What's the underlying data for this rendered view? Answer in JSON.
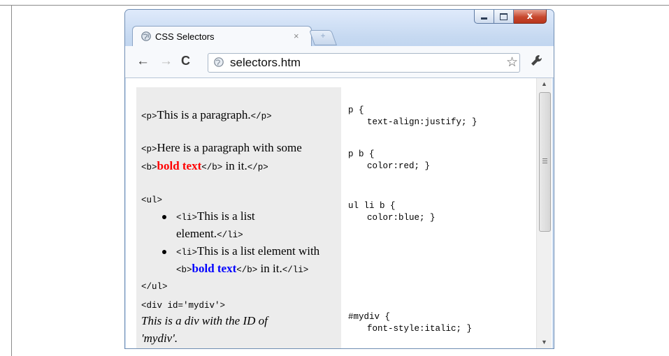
{
  "browser": {
    "tab_title": "CSS Selectors",
    "tab_close": "×",
    "new_tab": "+",
    "address": "selectors.htm",
    "window_buttons": {
      "minimize": "",
      "maximize": "",
      "close": "x"
    },
    "icons": {
      "back": "←",
      "forward": "→",
      "reload": "C",
      "bookmark": "☆"
    }
  },
  "page": {
    "left": {
      "p1": {
        "open": "<p>",
        "text": "This is a paragraph.",
        "close": "</p>"
      },
      "p2_line1": {
        "open": "<p>",
        "text": "Here is a paragraph with some"
      },
      "p2_line2": {
        "b_open": "<b>",
        "bold": "bold text",
        "b_close": "</b>",
        "text": " in it.",
        "close": "</p>"
      },
      "ul_open": "<ul>",
      "li1_line1": {
        "open": "<li>",
        "text": "This is a list"
      },
      "li1_line2": {
        "text": "element.",
        "close": "</li>"
      },
      "li2_line1": {
        "open": "<li>",
        "text": "This is a list element with"
      },
      "li2_line2": {
        "b_open": "<b>",
        "bold": "bold text",
        "b_close": "</b>",
        "text": " in it.",
        "close": "</li>"
      },
      "ul_close": "</ul>",
      "div_open": "<div id='mydiv'>",
      "div_line1": "This is a div with the ID of",
      "div_line2": "'mydiv'."
    },
    "right": {
      "rule1_sel": "p {",
      "rule1_decl": "text-align:justify; }",
      "rule2_sel": "p b {",
      "rule2_decl": "color:red; }",
      "rule3_sel": "ul li b {",
      "rule3_decl": "color:blue; }",
      "rule4_sel": "#mydiv {",
      "rule4_decl": "font-style:italic; }"
    }
  },
  "scrollbar": {
    "up": "▲",
    "down": "▼"
  },
  "colors": {
    "bold_red": "#ff0000",
    "bold_blue": "#0000ff",
    "left_bg": "#ececec"
  }
}
